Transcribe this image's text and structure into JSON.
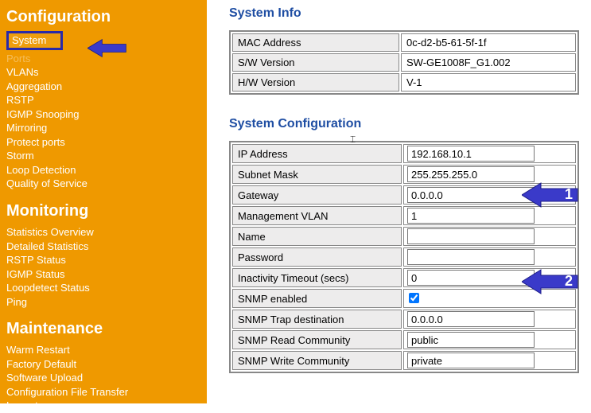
{
  "sidebar": {
    "sections": [
      {
        "title": "Configuration",
        "items": [
          "System",
          "Ports",
          "VLANs",
          "Aggregation",
          "RSTP",
          "IGMP Snooping",
          "Mirroring",
          "Protect ports",
          "Storm",
          "Loop Detection",
          "Quality of Service"
        ]
      },
      {
        "title": "Monitoring",
        "items": [
          "Statistics Overview",
          "Detailed Statistics",
          "RSTP Status",
          "IGMP Status",
          "Loopdetect Status",
          "Ping"
        ]
      },
      {
        "title": "Maintenance",
        "items": [
          "Warm Restart",
          "Factory Default",
          "Software Upload",
          "Configuration File Transfer",
          "Logout"
        ]
      }
    ]
  },
  "system_info": {
    "title": "System Info",
    "rows": [
      {
        "label": "MAC Address",
        "value": "0c-d2-b5-61-5f-1f"
      },
      {
        "label": "S/W Version",
        "value": "SW-GE1008F_G1.002"
      },
      {
        "label": "H/W Version",
        "value": "V-1"
      }
    ]
  },
  "system_config": {
    "title": "System Configuration",
    "fields": {
      "ip_address": {
        "label": "IP Address",
        "value": "192.168.10.1",
        "type": "text"
      },
      "subnet_mask": {
        "label": "Subnet Mask",
        "value": "255.255.255.0",
        "type": "text"
      },
      "gateway": {
        "label": "Gateway",
        "value": "0.0.0.0",
        "type": "text"
      },
      "mgmt_vlan": {
        "label": "Management VLAN",
        "value": "1",
        "type": "text"
      },
      "name": {
        "label": "Name",
        "value": "",
        "type": "text"
      },
      "password": {
        "label": "Password",
        "value": "",
        "type": "password"
      },
      "inactivity": {
        "label": "Inactivity Timeout (secs)",
        "value": "0",
        "type": "text"
      },
      "snmp_enabled": {
        "label": "SNMP enabled",
        "value": "true",
        "type": "checkbox"
      },
      "snmp_trap": {
        "label": "SNMP Trap destination",
        "value": "0.0.0.0",
        "type": "text"
      },
      "snmp_read": {
        "label": "SNMP Read Community",
        "value": "public",
        "type": "text"
      },
      "snmp_write": {
        "label": "SNMP Write Community",
        "value": "private",
        "type": "text"
      }
    }
  },
  "callouts": {
    "one": "1",
    "two": "2"
  }
}
